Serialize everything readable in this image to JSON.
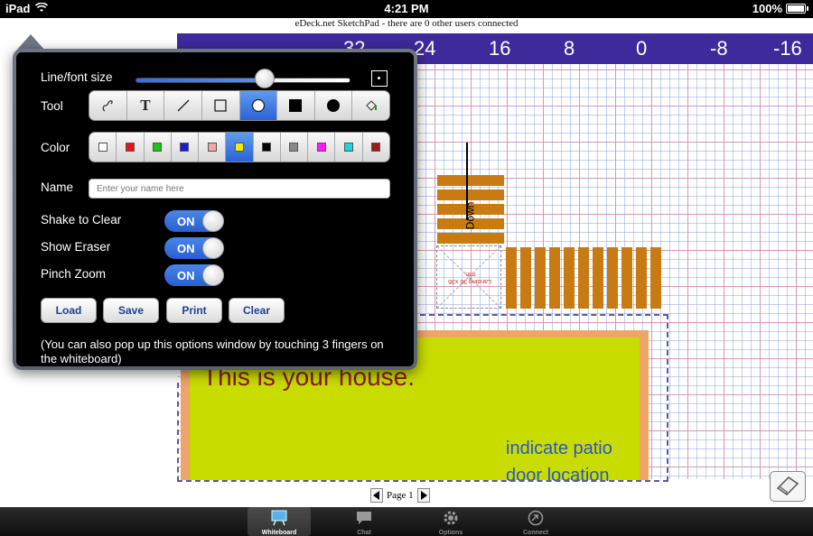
{
  "status_bar": {
    "device": "iPad",
    "time": "4:21 PM",
    "battery": "100%"
  },
  "title": "eDeck.net SketchPad - there are 0 other users connected",
  "ruler": {
    "numbers": [
      "32",
      "24",
      "16",
      "8",
      "0",
      "-8",
      "-16"
    ]
  },
  "whiteboard": {
    "house_text": "This is your house.",
    "patio_line1": "indicate patio",
    "patio_line2": "door location",
    "down_label": "Down",
    "landing_text": "Landing 36 x36 min."
  },
  "options": {
    "size_label": "Line/font size",
    "size_level": 0.6,
    "tool_label": "Tool",
    "tools": [
      "lasso-icon",
      "text-icon",
      "line-icon",
      "rect-outline-icon",
      "circle-outline-icon",
      "rect-filled-icon",
      "circle-filled-icon",
      "fill-bucket-icon"
    ],
    "tool_selected": "circle-outline-icon",
    "color_label": "Color",
    "colors": [
      "#ffffff",
      "#e8141c",
      "#19c419",
      "#1a1ad8",
      "#f2a8a4",
      "#f2ea00",
      "#000000",
      "#888888",
      "#ff1aff",
      "#1ad4e0",
      "#a01a1a"
    ],
    "color_selected": "#f2ea00",
    "name_label": "Name",
    "name_placeholder": "Enter your name here",
    "toggles": [
      {
        "label": "Shake to Clear",
        "state": "ON"
      },
      {
        "label": "Show Eraser",
        "state": "ON"
      },
      {
        "label": "Pinch Zoom",
        "state": "ON"
      }
    ],
    "buttons": [
      "Load",
      "Save",
      "Print",
      "Clear"
    ],
    "hint": "(You can also pop up this options window by touching 3 fingers on the whiteboard)"
  },
  "pager": {
    "label": "Page 1"
  },
  "tabs": [
    {
      "label": "Whiteboard",
      "icon": "whiteboard-icon",
      "active": true
    },
    {
      "label": "Chat",
      "icon": "chat-icon",
      "active": false
    },
    {
      "label": "Options",
      "icon": "gear-icon",
      "active": false
    },
    {
      "label": "Connect",
      "icon": "connect-icon",
      "active": false
    }
  ]
}
